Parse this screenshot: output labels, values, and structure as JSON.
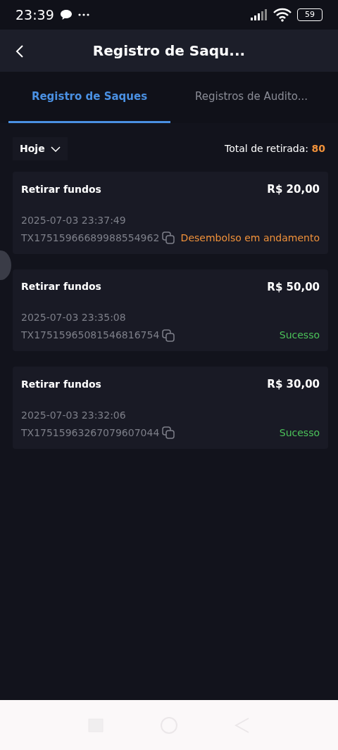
{
  "status_bar": {
    "time": "23:39",
    "battery": "59"
  },
  "header": {
    "title": "Registro de Saqu..."
  },
  "tabs": [
    {
      "label": "Registro de Saques",
      "selected": true
    },
    {
      "label": "Registros de Audito...",
      "selected": false
    }
  ],
  "filter": {
    "label": "Hoje"
  },
  "total": {
    "label": "Total de retirada:",
    "value": "80"
  },
  "records": [
    {
      "title": "Retirar fundos",
      "amount": "R$ 20,00",
      "datetime": "2025-07-03 23:37:49",
      "tx_id": "TX17515966689988554962",
      "status": "Desembolso em andamento",
      "kind": "pending"
    },
    {
      "title": "Retirar fundos",
      "amount": "R$ 50,00",
      "datetime": "2025-07-03 23:35:08",
      "tx_id": "TX17515965081546816754",
      "status": "Sucesso",
      "kind": "success"
    },
    {
      "title": "Retirar fundos",
      "amount": "R$ 30,00",
      "datetime": "2025-07-03 23:32:06",
      "tx_id": "TX17515963267079607044",
      "status": "Sucesso",
      "kind": "success"
    }
  ]
}
